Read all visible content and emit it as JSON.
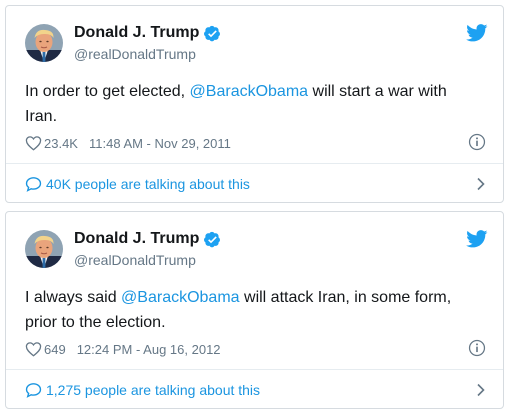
{
  "tweets": [
    {
      "display_name": "Donald J. Trump",
      "handle": "@realDonaldTrump",
      "text_before": "In order to get elected, ",
      "mention": "@BarackObama",
      "text_after": " will start a war with Iran.",
      "likes": "23.4K",
      "timestamp": "11:48 AM - Nov 29, 2011",
      "talking": "40K people are talking about this"
    },
    {
      "display_name": "Donald J. Trump",
      "handle": "@realDonaldTrump",
      "text_before": "I always said ",
      "mention": "@BarackObama",
      "text_after": " will attack Iran, in some form, prior to the election.",
      "likes": "649",
      "timestamp": "12:24 PM - Aug 16, 2012",
      "talking": "1,275 people are talking about this"
    }
  ],
  "icons": {
    "verified": "verified-badge-icon",
    "bird": "twitter-bird-icon",
    "heart": "heart-icon",
    "info": "info-icon",
    "comment": "comment-bubble-icon",
    "chevron": "chevron-right-icon"
  },
  "colors": {
    "link": "#1b95e0",
    "secondary_text": "#657786",
    "border": "#d6dbe0"
  }
}
